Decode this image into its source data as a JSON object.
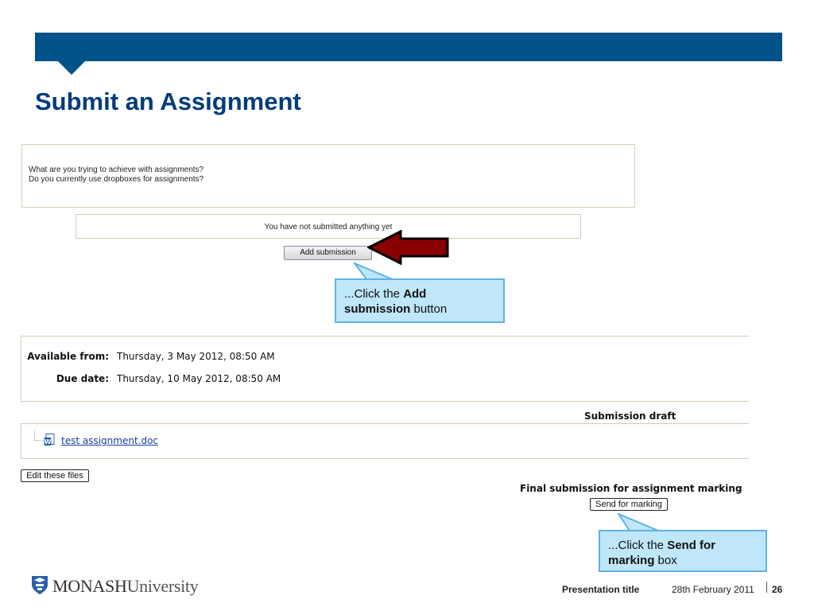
{
  "slide": {
    "title": "Submit an Assignment"
  },
  "assignment": {
    "intro_lines": [
      "What are you trying to achieve with assignments?",
      "Do you currently use dropboxes for assignments?"
    ],
    "status_text": "You have not submitted anything yet",
    "add_button_label": "Add submission",
    "available_from_label": "Available from:",
    "available_from_value": "Thursday, 3 May 2012, 08:50 AM",
    "due_date_label": "Due date:",
    "due_date_value": "Thursday, 10 May 2012, 08:50 AM",
    "draft_heading": "Submission draft",
    "file_name": "test assignment.doc",
    "edit_button_label": "Edit these files",
    "final_heading": "Final submission for assignment marking",
    "send_button_label": "Send for marking"
  },
  "callouts": {
    "add": {
      "prefix": "...Click the ",
      "bold": "Add submission",
      "suffix": " button"
    },
    "send": {
      "prefix": "...Click the ",
      "bold": "Send for marking",
      "suffix": " box"
    }
  },
  "footer": {
    "logo_name": "MONASH",
    "logo_suffix": "University",
    "presentation_title": "Presentation title",
    "date": "28th February 2011",
    "page_number": "26"
  },
  "colors": {
    "banner": "#005288",
    "title": "#003c7a",
    "callout_fill": "#bfe6f9",
    "callout_border": "#5fb2e1",
    "arrow": "#8b0000"
  },
  "icons": {
    "arrow": "red-left-arrow-icon",
    "file": "word-document-icon",
    "logo": "monash-shield-logo"
  }
}
